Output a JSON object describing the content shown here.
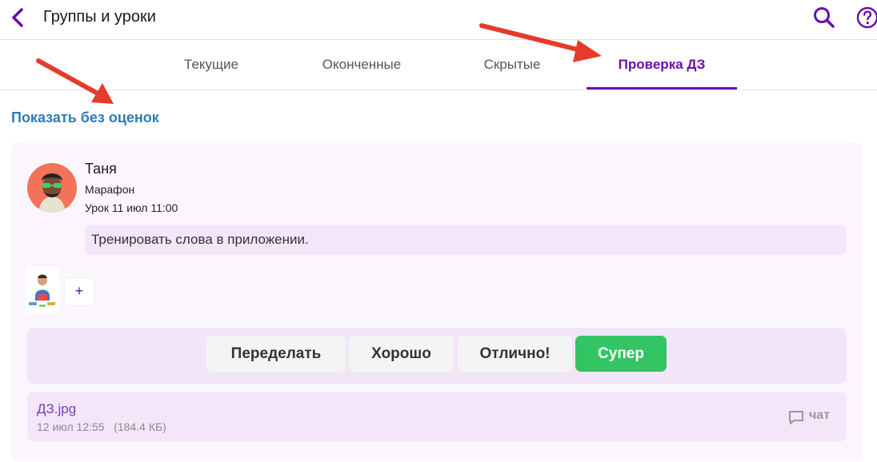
{
  "header": {
    "title": "Группы и уроки",
    "back_icon": "chevron-left-icon",
    "search_icon": "search-icon",
    "help_icon": "help-circle-icon"
  },
  "tabs": [
    {
      "label": "Текущие",
      "active": false
    },
    {
      "label": "Оконченные",
      "active": false
    },
    {
      "label": "Скрытые",
      "active": false
    },
    {
      "label": "Проверка ДЗ",
      "active": true
    }
  ],
  "filter_link": "Показать без оценок",
  "homework": {
    "student_name": "Таня",
    "group": "Марафон",
    "lesson": "Урок 11 июл 11:00",
    "task": "Тренировать слова в приложении.",
    "add_label": "+",
    "grades": [
      {
        "label": "Переделать"
      },
      {
        "label": "Хорошо"
      },
      {
        "label": "Отлично!"
      },
      {
        "label": "Супер"
      }
    ],
    "file": {
      "name": "ДЗ.jpg",
      "meta": "12 июл 12:55   (184.4 КБ)",
      "chat_label": "чат"
    }
  },
  "colors": {
    "accent": "#6a0dad",
    "link": "#2f7bb5",
    "card_bg": "#fbf6fd",
    "panel_bg": "#f2e5f8",
    "super": "#33c463",
    "annotation_arrow": "#e53b2c"
  }
}
